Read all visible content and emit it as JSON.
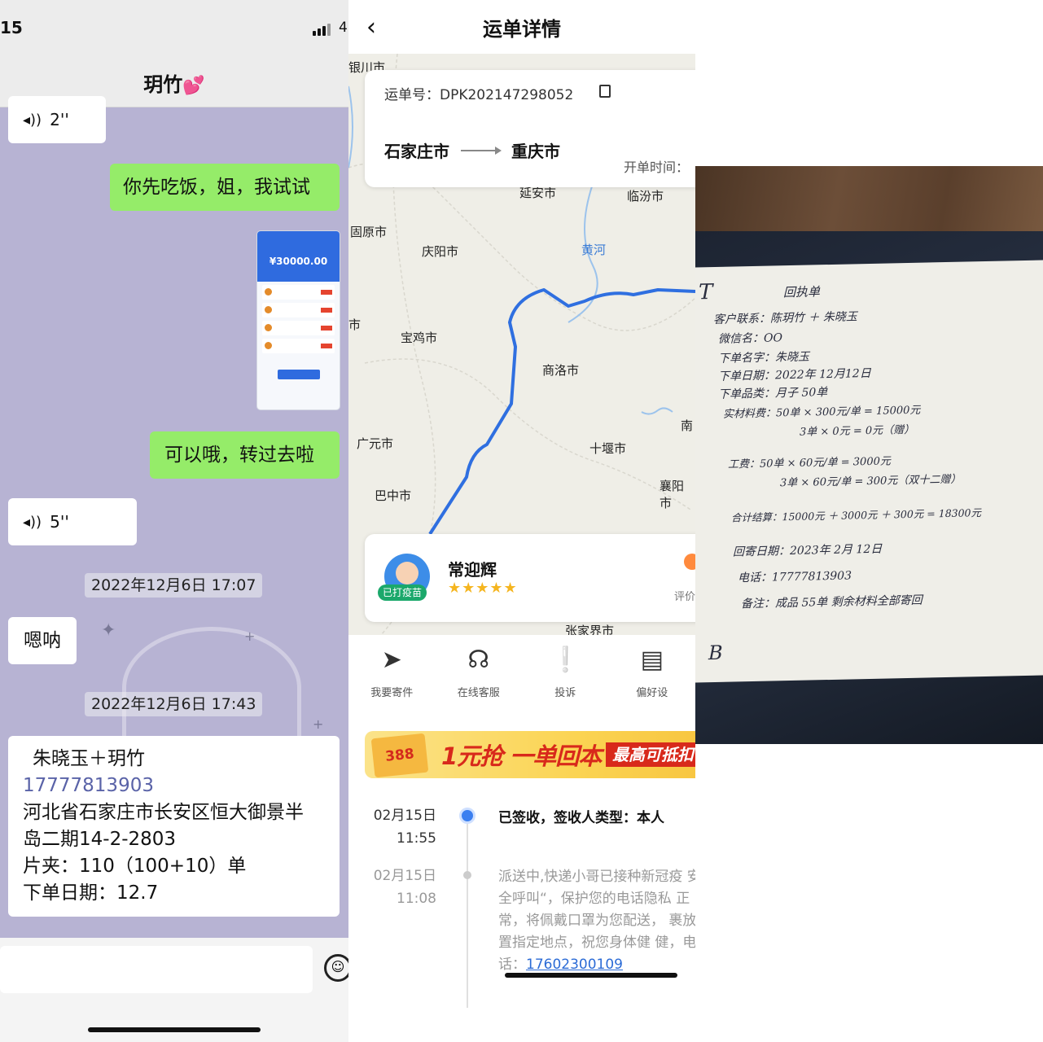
{
  "chat": {
    "status_time": "15",
    "battery_text": "4",
    "title": "玥竹",
    "title_emoji": "💕",
    "messages": {
      "voice1": {
        "duration": "2''"
      },
      "green1": "你先吃饭，姐，我试试",
      "screenshot": {
        "amount": "¥30000.00"
      },
      "green2": "可以哦，转过去啦",
      "voice2": {
        "duration": "5''"
      },
      "ts1": "2022年12月6日 17:07",
      "white1": "嗯呐",
      "ts2": "2022年12月6日 17:43",
      "address_card": {
        "line1": "朱晓玉＋玥竹",
        "phone": "17777813903",
        "line3": "河北省石家庄市长安区恒大御景半",
        "line4": "岛二期14-2-2803",
        "line5": "片夹：110（100+10）单",
        "line6": "下单日期：12.7"
      }
    }
  },
  "waybill": {
    "title": "运单详情",
    "waybill_number": "运单号：DPK202147298052",
    "origin": "石家庄市",
    "destination": "重庆市",
    "order_time_label": "开单时间：",
    "map_cities": [
      "银川市",
      "延安市",
      "临汾市",
      "固原市",
      "庆阳市",
      "黄河",
      "宝鸡市",
      "商洛市",
      "市",
      "广元市",
      "十堰市",
      "南",
      "巴中市",
      "襄阳市",
      "张家界市"
    ],
    "courier": {
      "name": "常迎辉",
      "badge": "已打疫苗",
      "stars": "★★★★★",
      "rate_label": "评价"
    },
    "actions": [
      {
        "icon": "send-icon",
        "label": "我要寄件"
      },
      {
        "icon": "headset-icon",
        "label": "在线客服"
      },
      {
        "icon": "complaint-icon",
        "label": "投诉"
      },
      {
        "icon": "preference-icon",
        "label": "偏好设"
      }
    ],
    "banner": {
      "amount": "388",
      "main": "1元抢 一单回本",
      "tag": "最高可抵扣"
    },
    "timeline": [
      {
        "date": "02月15日",
        "time": "11:55",
        "head": "已签收，签收人类型：本人"
      },
      {
        "date": "02月15日",
        "time": "11:08",
        "body": "派送中,快递小哥已接种新冠疫 安全呼叫“，保护您的电话隐私 正常，将佩戴口罩为您配送， 裹放置指定地点，祝您身体健 健，电话：",
        "phone": "17602300109"
      }
    ]
  },
  "note": {
    "lines": [
      "回执单",
      "客户联系：陈玥竹 ＋ 朱晓玉",
      "微信名：OO",
      "下单名字：朱晓玉",
      "下单日期：2022年 12月12日",
      "下单品类：月子 50单",
      "实材料费：50单 × 300元/单 = 15000元",
      "3单 × 0元 = 0元（赠）",
      "工费：50单 × 60元/单 = 3000元",
      "3单 × 60元/单 = 300元（双十二赠）",
      "合计结算：15000元 ＋ 3000元 ＋ 300元 = 18300元",
      "回寄日期：2023年 2月 12日",
      "电话：17777813903",
      "备注：成品 55单 剩余材料全部寄回",
      "B",
      "T"
    ]
  }
}
